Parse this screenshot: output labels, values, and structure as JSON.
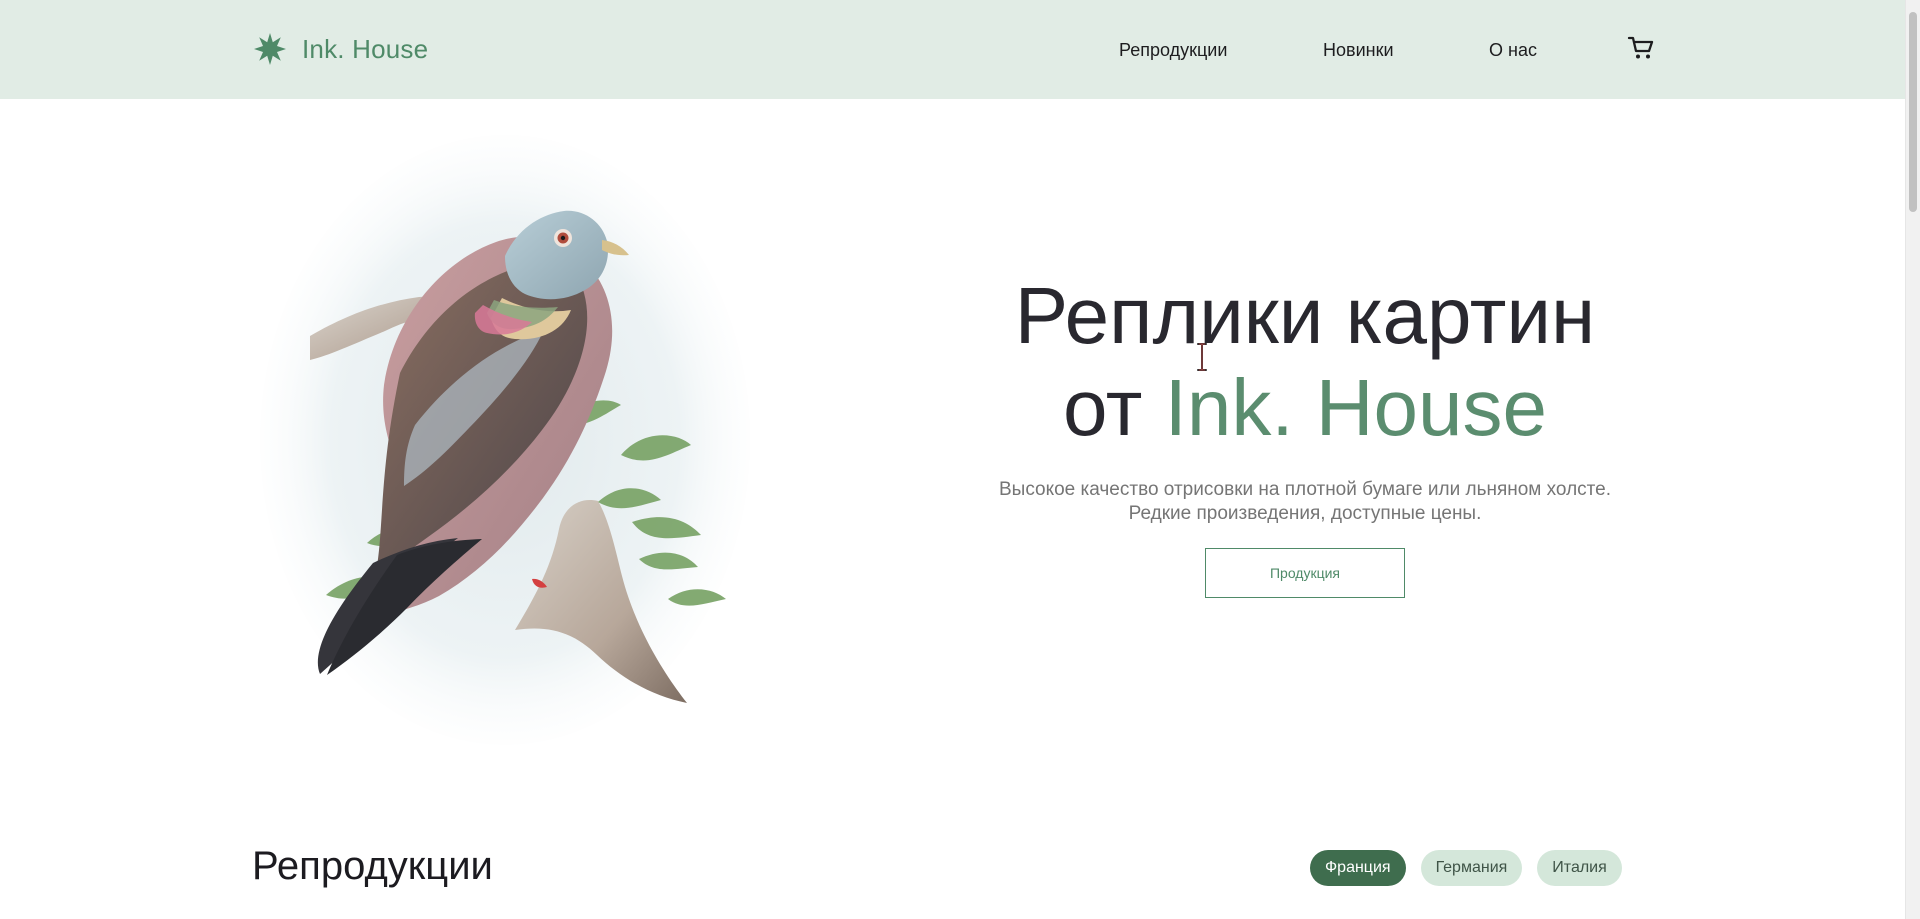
{
  "header": {
    "logo_text": "Ink. House",
    "nav": [
      "Репродукции",
      "Новинки",
      "О нас"
    ],
    "cart_icon": "cart-icon",
    "logo_icon": "star-burst-logo-icon",
    "background_color": "#e1ece5",
    "accent_color": "#4f8a68"
  },
  "hero": {
    "title_line1": "Реплики картин",
    "title_line2_prefix": "от",
    "title_line2_brand": "Ink. House",
    "subtitle_line1": "Высокое качество отрисовки на плотной бумаге или льняном холсте.",
    "subtitle_line2": "Редкие произведения, доступные цены.",
    "button_label": "Продукция"
  },
  "section": {
    "title": "Репродукции",
    "filters": [
      "Франция",
      "Германия",
      "Италия"
    ],
    "active_filter": "Франция"
  }
}
